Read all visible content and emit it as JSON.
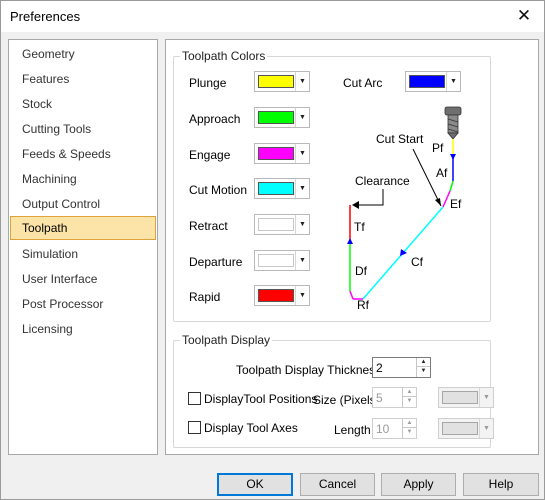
{
  "window": {
    "title": "Preferences",
    "close_glyph": "✕"
  },
  "sidebar": {
    "items": [
      {
        "label": "Geometry"
      },
      {
        "label": "Features"
      },
      {
        "label": "Stock"
      },
      {
        "label": "Cutting Tools"
      },
      {
        "label": "Feeds & Speeds"
      },
      {
        "label": "Machining"
      },
      {
        "label": "Output Control"
      },
      {
        "label": "Toolpath",
        "selected": true
      },
      {
        "label": "Simulation"
      },
      {
        "label": "User Interface"
      },
      {
        "label": "Post Processor"
      },
      {
        "label": "Licensing"
      }
    ]
  },
  "toolpath_colors": {
    "legend": "Toolpath Colors",
    "items": [
      {
        "label": "Plunge",
        "color": "#ffff00"
      },
      {
        "label": "Approach",
        "color": "#00ff00"
      },
      {
        "label": "Engage",
        "color": "#ff00ff"
      },
      {
        "label": "Cut Motion",
        "color": "#00ffff"
      },
      {
        "label": "Retract",
        "color": "#ffffff"
      },
      {
        "label": "Departure",
        "color": "#ffffff"
      },
      {
        "label": "Rapid",
        "color": "#ff0000"
      }
    ],
    "cut_arc": {
      "label": "Cut Arc",
      "color": "#0000ff"
    }
  },
  "diagram": {
    "labels": {
      "cut_start": "Cut Start",
      "clearance": "Clearance",
      "pf": "Pf",
      "af": "Af",
      "ef": "Ef",
      "cf": "Cf",
      "rf": "Rf",
      "df": "Df",
      "tf": "Tf"
    }
  },
  "toolpath_display": {
    "legend": "Toolpath Display",
    "thickness_label": "Toolpath Display Thickness:",
    "thickness_value": "2",
    "display_tool_positions": {
      "label": "DisplayTool Positions",
      "checked": false
    },
    "size_label": "Size (Pixels)",
    "size_value": "5",
    "display_tool_axes": {
      "label": "Display Tool Axes",
      "checked": false
    },
    "length_label": "Length",
    "length_value": "10",
    "disabled_swatch_color": "#e1e1e1"
  },
  "buttons": {
    "ok": "OK",
    "cancel": "Cancel",
    "apply": "Apply",
    "help": "Help"
  },
  "colors": {
    "selection_bg": "#fce4a8",
    "selection_border": "#e0a23a",
    "focus_blue": "#0078d7"
  }
}
